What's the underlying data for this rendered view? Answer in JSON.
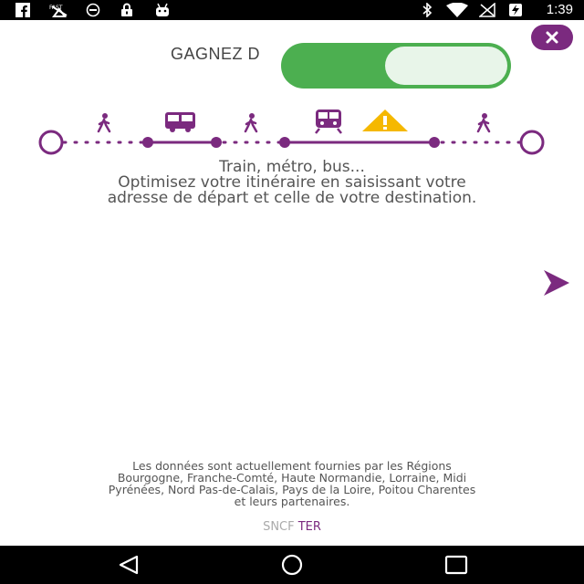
{
  "status_bar": {
    "time": "1:39",
    "left_icons": [
      "facebook-icon",
      "fast-vpn-icon",
      "blocked-icon",
      "lock-icon",
      "android-icon"
    ],
    "right_icons": [
      "bluetooth-icon",
      "wifi-icon",
      "no-signal-icon",
      "battery-charging-icon"
    ]
  },
  "header": {
    "title": "GAGNEZ D",
    "toggle_on": true,
    "close_icon": "close-icon"
  },
  "itinerary": {
    "segments": [
      "walk",
      "bus",
      "walk",
      "train-warning",
      "walk"
    ],
    "accent_color": "#7b2a7f",
    "warning_color": "#f5b800"
  },
  "description": {
    "line1": "Train, métro, bus...",
    "line2": "Optimisez votre itinéraire en saisissant votre",
    "line3": "adresse de départ et celle de votre destination."
  },
  "next_icon": "chevron-right-icon",
  "credits": {
    "line1": "Les données sont actuellement fournies par les Régions",
    "line2": "Bourgogne, Franche-Comté, Haute Normandie, Lorraine, Midi",
    "line3": "Pyrénées, Nord Pas-de-Calais, Pays de la Loire, Poitou Charentes",
    "line4": "et leurs partenaires."
  },
  "brand": {
    "sncf": "SNCF",
    "ter": "TER"
  },
  "colors": {
    "primary": "#7b2a7f",
    "toggle": "#4caf50"
  }
}
